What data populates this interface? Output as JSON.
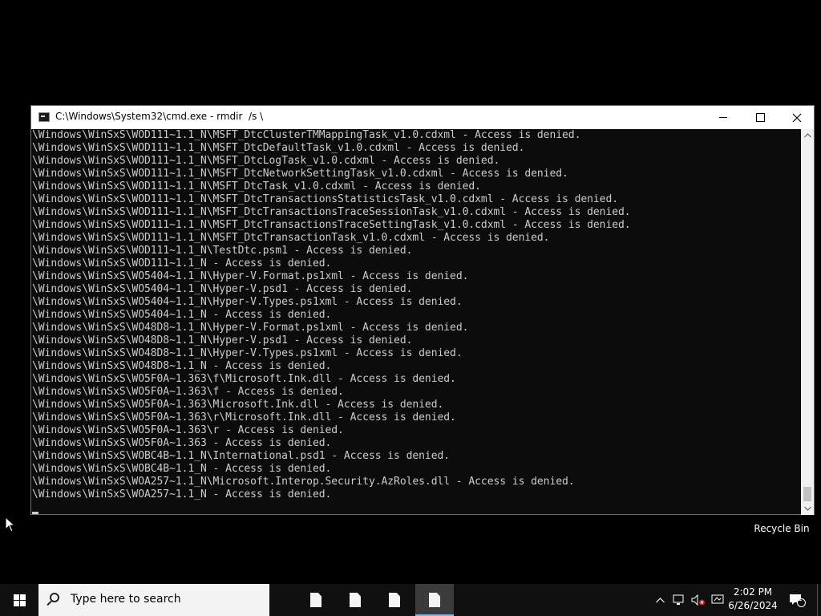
{
  "desktop": {
    "recycle_bin_label": "Recycle Bin"
  },
  "window": {
    "title": "C:\\Windows\\System32\\cmd.exe - rmdir  /s \\",
    "minimize_icon": "minimize-icon",
    "maximize_icon": "maximize-icon",
    "close_symbol": "✕"
  },
  "console": {
    "lines": [
      "\\Windows\\WinSxS\\WOD111~1.1_N\\MSFT_DtcClusterTMMappingTask_v1.0.cdxml - Access is denied.",
      "\\Windows\\WinSxS\\WOD111~1.1_N\\MSFT_DtcDefaultTask_v1.0.cdxml - Access is denied.",
      "\\Windows\\WinSxS\\WOD111~1.1_N\\MSFT_DtcLogTask_v1.0.cdxml - Access is denied.",
      "\\Windows\\WinSxS\\WOD111~1.1_N\\MSFT_DtcNetworkSettingTask_v1.0.cdxml - Access is denied.",
      "\\Windows\\WinSxS\\WOD111~1.1_N\\MSFT_DtcTask_v1.0.cdxml - Access is denied.",
      "\\Windows\\WinSxS\\WOD111~1.1_N\\MSFT_DtcTransactionsStatisticsTask_v1.0.cdxml - Access is denied.",
      "\\Windows\\WinSxS\\WOD111~1.1_N\\MSFT_DtcTransactionsTraceSessionTask_v1.0.cdxml - Access is denied.",
      "\\Windows\\WinSxS\\WOD111~1.1_N\\MSFT_DtcTransactionsTraceSettingTask_v1.0.cdxml - Access is denied.",
      "\\Windows\\WinSxS\\WOD111~1.1_N\\MSFT_DtcTransactionTask_v1.0.cdxml - Access is denied.",
      "\\Windows\\WinSxS\\WOD111~1.1_N\\TestDtc.psm1 - Access is denied.",
      "\\Windows\\WinSxS\\WOD111~1.1_N - Access is denied.",
      "\\Windows\\WinSxS\\WO5404~1.1_N\\Hyper-V.Format.ps1xml - Access is denied.",
      "\\Windows\\WinSxS\\WO5404~1.1_N\\Hyper-V.psd1 - Access is denied.",
      "\\Windows\\WinSxS\\WO5404~1.1_N\\Hyper-V.Types.ps1xml - Access is denied.",
      "\\Windows\\WinSxS\\WO5404~1.1_N - Access is denied.",
      "\\Windows\\WinSxS\\WO48D8~1.1_N\\Hyper-V.Format.ps1xml - Access is denied.",
      "\\Windows\\WinSxS\\WO48D8~1.1_N\\Hyper-V.psd1 - Access is denied.",
      "\\Windows\\WinSxS\\WO48D8~1.1_N\\Hyper-V.Types.ps1xml - Access is denied.",
      "\\Windows\\WinSxS\\WO48D8~1.1_N - Access is denied.",
      "\\Windows\\WinSxS\\WO5F0A~1.363\\f\\Microsoft.Ink.dll - Access is denied.",
      "\\Windows\\WinSxS\\WO5F0A~1.363\\f - Access is denied.",
      "\\Windows\\WinSxS\\WO5F0A~1.363\\Microsoft.Ink.dll - Access is denied.",
      "\\Windows\\WinSxS\\WO5F0A~1.363\\r\\Microsoft.Ink.dll - Access is denied.",
      "\\Windows\\WinSxS\\WO5F0A~1.363\\r - Access is denied.",
      "\\Windows\\WinSxS\\WO5F0A~1.363 - Access is denied.",
      "\\Windows\\WinSxS\\WOBC4B~1.1_N\\International.psd1 - Access is denied.",
      "\\Windows\\WinSxS\\WOBC4B~1.1_N - Access is denied.",
      "\\Windows\\WinSxS\\WOA257~1.1_N\\Microsoft.Interop.Security.AzRoles.dll - Access is denied.",
      "\\Windows\\WinSxS\\WOA257~1.1_N - Access is denied."
    ]
  },
  "taskbar": {
    "search_placeholder": "Type here to search",
    "apps": [
      "file-icon",
      "file-icon",
      "file-icon",
      "file-icon"
    ],
    "tray": {
      "chevron": "^",
      "notification_count": "1"
    },
    "clock": {
      "time": "2:02 PM",
      "date": "6/26/2024"
    }
  },
  "colors": {
    "console_bg": "#0c0c0c",
    "console_text": "#cccccc",
    "taskbar_bg": "#101010",
    "active_indicator": "#76b9ed"
  }
}
